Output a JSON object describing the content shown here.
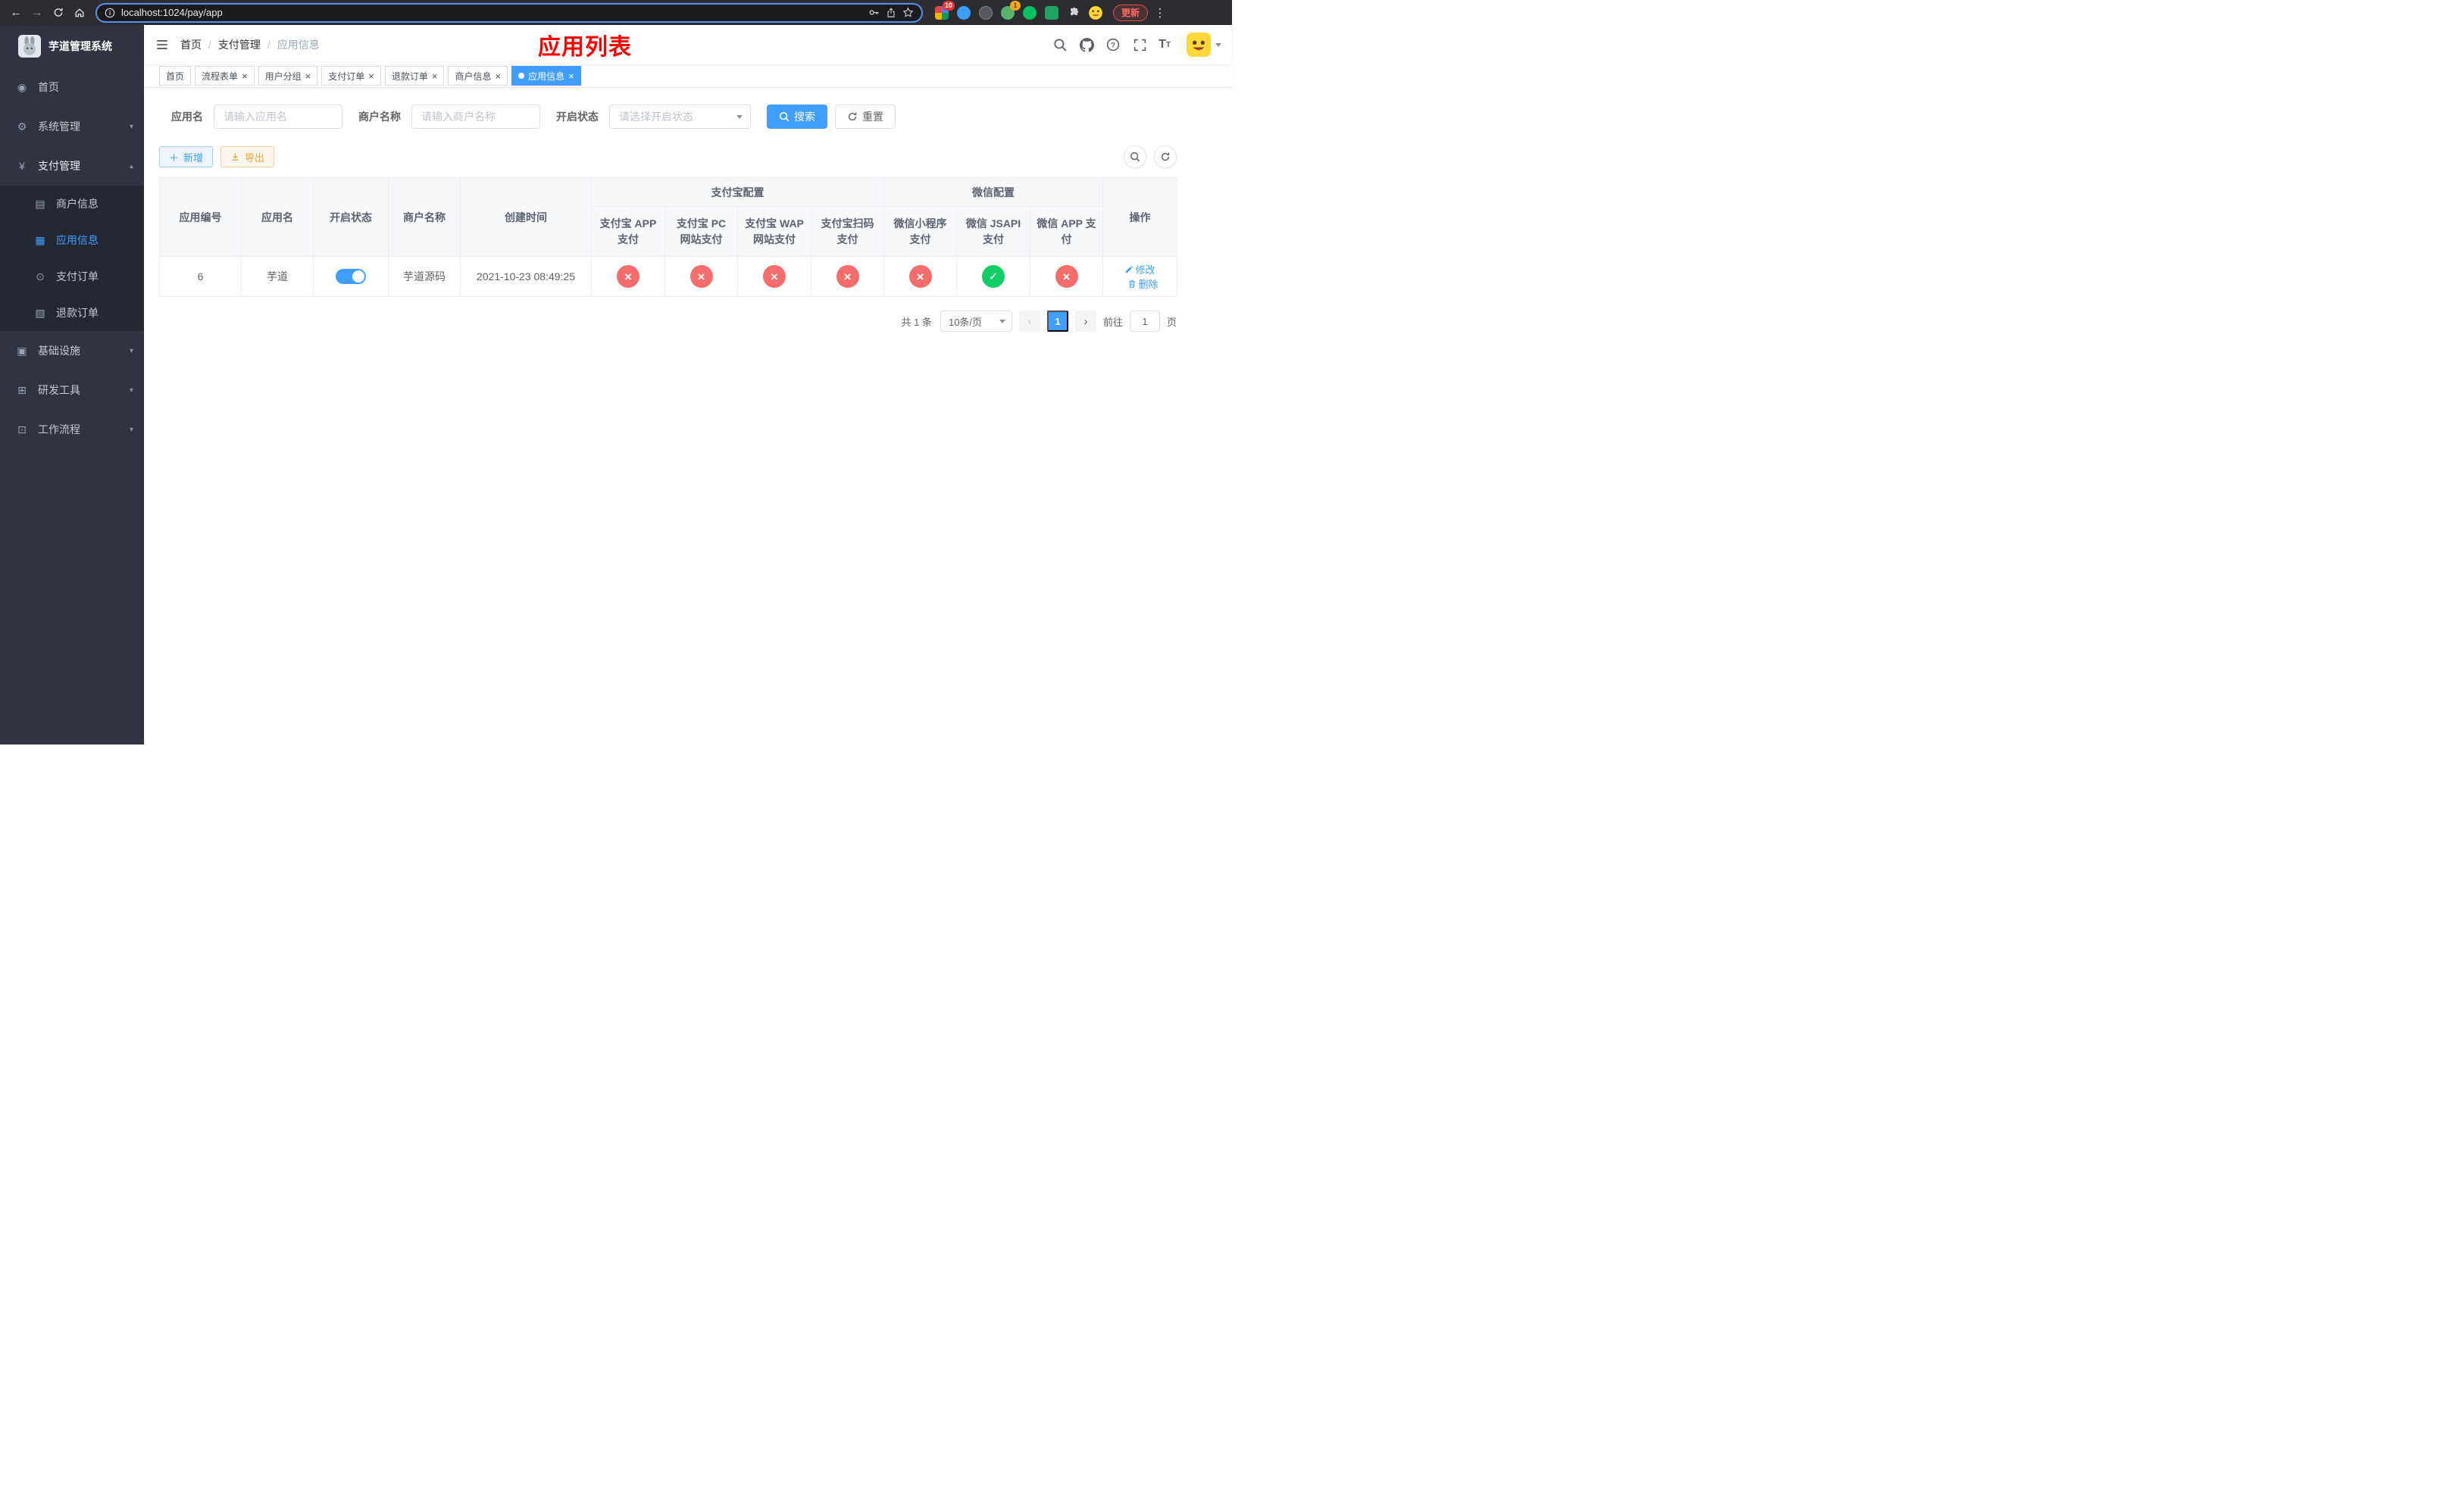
{
  "browser": {
    "url": "localhost:1024/pay/app",
    "update_label": "更新",
    "ext_badge_count": "10",
    "ext_badge_one": "1"
  },
  "sidebar": {
    "title": "芋道管理系统",
    "menu": [
      {
        "label": "首页"
      },
      {
        "label": "系统管理"
      },
      {
        "label": "支付管理"
      },
      {
        "label": "基础设施"
      },
      {
        "label": "研发工具"
      },
      {
        "label": "工作流程"
      }
    ],
    "pay_submenu": [
      {
        "label": "商户信息"
      },
      {
        "label": "应用信息"
      },
      {
        "label": "支付订单"
      },
      {
        "label": "退款订单"
      }
    ]
  },
  "header": {
    "breadcrumb": [
      "首页",
      "支付管理",
      "应用信息"
    ],
    "page_title": "应用列表"
  },
  "tabs": [
    {
      "label": "首页"
    },
    {
      "label": "流程表单"
    },
    {
      "label": "用户分组"
    },
    {
      "label": "支付订单"
    },
    {
      "label": "退款订单"
    },
    {
      "label": "商户信息"
    },
    {
      "label": "应用信息"
    }
  ],
  "filters": {
    "app_name_label": "应用名",
    "app_name_placeholder": "请输入应用名",
    "merchant_label": "商户名称",
    "merchant_placeholder": "请输入商户名称",
    "status_label": "开启状态",
    "status_placeholder": "请选择开启状态",
    "search_label": "搜索",
    "reset_label": "重置"
  },
  "toolbar": {
    "add_label": "新增",
    "export_label": "导出"
  },
  "table": {
    "headers": {
      "app_id": "应用编号",
      "app_name": "应用名",
      "status": "开启状态",
      "merchant": "商户名称",
      "created": "创建时间",
      "alipay_group": "支付宝配置",
      "wechat_group": "微信配置",
      "alipay_app": "支付宝 APP 支付",
      "alipay_pc": "支付宝 PC 网站支付",
      "alipay_wap": "支付宝 WAP 网站支付",
      "alipay_qr": "支付宝扫码支付",
      "wx_mini": "微信小程序支付",
      "wx_jsapi": "微信 JSAPI 支付",
      "wx_app": "微信 APP 支付",
      "ops": "操作"
    },
    "rows": [
      {
        "app_id": "6",
        "app_name": "芋道",
        "status_on": true,
        "merchant": "芋道源码",
        "created": "2021-10-23 08:49:25",
        "pay_status": {
          "alipay_app": false,
          "alipay_pc": false,
          "alipay_wap": false,
          "alipay_qr": false,
          "wx_mini": false,
          "wx_jsapi": true,
          "wx_app": false
        },
        "edit_label": "修改",
        "delete_label": "删除"
      }
    ]
  },
  "pagination": {
    "total": "共 1 条",
    "page_size": "10条/页",
    "page": "1",
    "goto_label": "前往",
    "goto_value": "1",
    "unit_label": "页"
  },
  "colors": {
    "primary": "#409eff",
    "danger": "#f56c6c",
    "success": "#13ce66",
    "title_red": "#ff0000",
    "sidebar_bg": "#2f3440",
    "submenu_bg": "#232832"
  }
}
